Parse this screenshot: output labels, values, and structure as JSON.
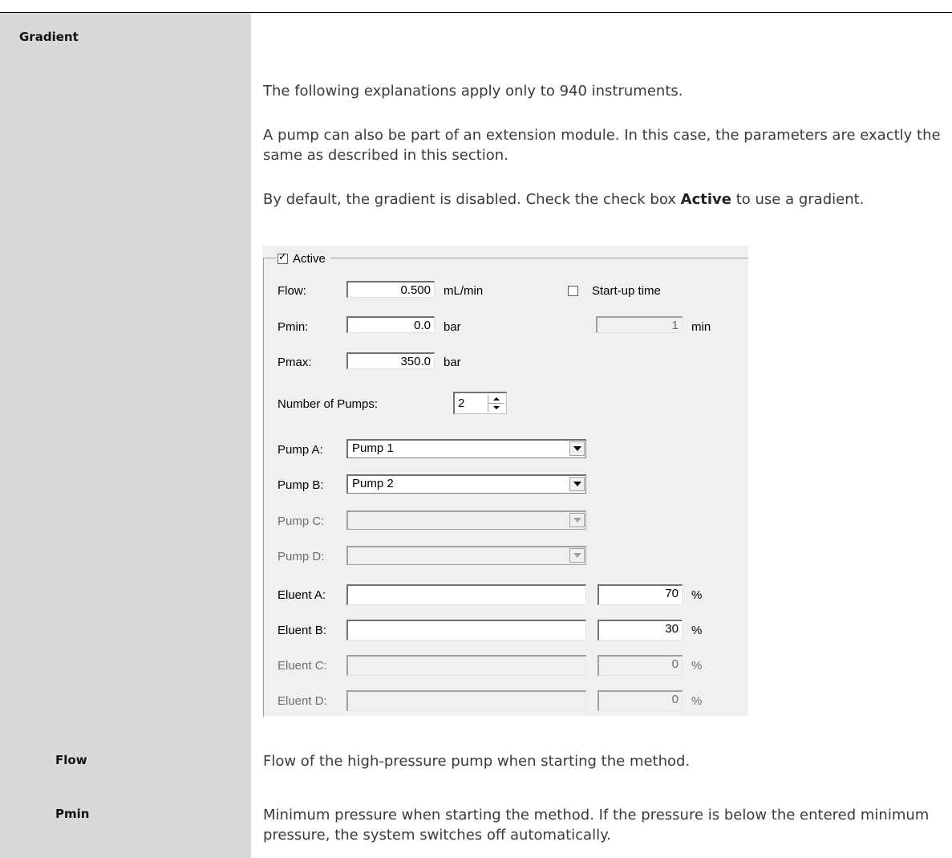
{
  "sidebar": {
    "heading": "Gradient",
    "flow_heading": "Flow",
    "pmin_heading": "Pmin"
  },
  "content": {
    "para1": "The following explanations apply only to 940 instruments.",
    "para2": "A pump can also be part of an extension module. In this case, the parameters are exactly the same as described in this section.",
    "para3_before": "By default, the gradient is disabled. Check the check box ",
    "para3_bold": "Active",
    "para3_after": " to use a gradient.",
    "flow_desc": "Flow of the high-pressure pump when starting the method.",
    "pmin_desc": "Minimum pressure when starting the method. If the pressure is below the entered minimum pressure, the system switches off automatically."
  },
  "dialog": {
    "active_label": "Active",
    "active_checked": true,
    "flow_label": "Flow:",
    "flow_value": "0.500",
    "flow_unit": "mL/min",
    "startup_label": "Start-up time",
    "startup_checked": false,
    "pmin_label": "Pmin:",
    "pmin_value": "0.0",
    "pmin_unit": "bar",
    "startup_value": "1",
    "startup_unit": "min",
    "pmax_label": "Pmax:",
    "pmax_value": "350.0",
    "pmax_unit": "bar",
    "num_pumps_label": "Number of Pumps:",
    "num_pumps_value": "2",
    "pump_a_label": "Pump A:",
    "pump_a_value": "Pump 1",
    "pump_b_label": "Pump B:",
    "pump_b_value": "Pump 2",
    "pump_c_label": "Pump C:",
    "pump_d_label": "Pump D:",
    "eluent_a_label": "Eluent A:",
    "eluent_a_pct": "70",
    "eluent_b_label": "Eluent B:",
    "eluent_b_pct": "30",
    "eluent_c_label": "Eluent C:",
    "eluent_c_pct": "0",
    "eluent_d_label": "Eluent D:",
    "eluent_d_pct": "0",
    "percent_unit": "%"
  }
}
